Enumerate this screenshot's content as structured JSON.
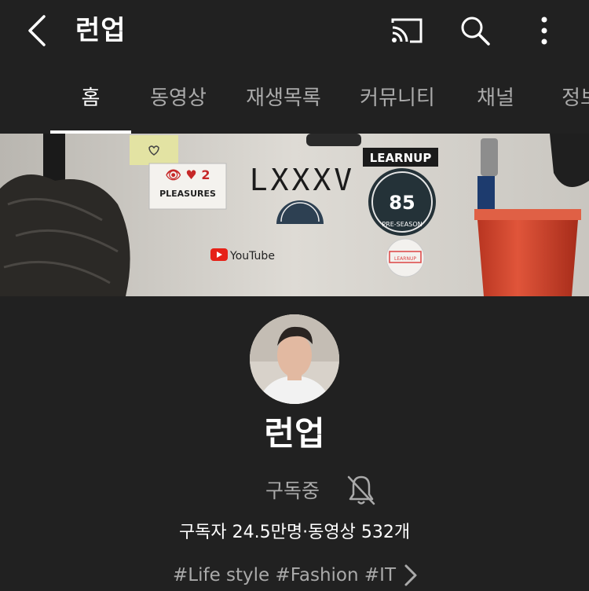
{
  "header": {
    "title": "런업",
    "back_icon": "chevron-left-icon",
    "actions": [
      "cast-icon",
      "search-icon",
      "more-vertical-icon"
    ]
  },
  "tabs": [
    {
      "label": "홈",
      "active": true
    },
    {
      "label": "동영상",
      "active": false
    },
    {
      "label": "재생목록",
      "active": false
    },
    {
      "label": "커뮤니티",
      "active": false
    },
    {
      "label": "채널",
      "active": false
    },
    {
      "label": "정보",
      "active": false
    }
  ],
  "banner": {
    "stickers": {
      "pleasures": "PLEASURES",
      "lxxxv": "LXXXV",
      "learnup": "LEARNUP",
      "preseason_number": "85",
      "preseason_text": "PRE-SEASON",
      "youtube": "YouTube",
      "small_sticker": "LEARNUP"
    }
  },
  "channel": {
    "name": "런업",
    "subscribe_status": "구독중",
    "stats": "구독자 24.5만명·동영상 532개",
    "tags": "#Life style #Fashion #IT"
  },
  "colors": {
    "background": "#212121",
    "text_primary": "#ffffff",
    "text_secondary": "#aaaaaa",
    "banner_wall": "#d6d3cd",
    "cup_red": "#d9482b"
  }
}
